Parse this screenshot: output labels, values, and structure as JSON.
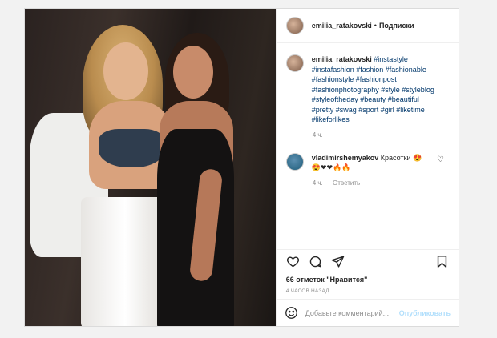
{
  "post": {
    "username": "emilia_ratakovski",
    "dot": "•",
    "follow_label": "Подписки",
    "caption": {
      "username": "emilia_ratakovski",
      "hashtags": "#instastyle #instafashion #fashion #fashionable #fashionstyle #fashionpost #fashionphotography #style #styleblog #styleoftheday #beauty #beautiful #pretty #swag #sport #girl #liketime #likeforlikes",
      "time": "4 ч."
    },
    "comment": {
      "username": "vladimirshemyakov",
      "text": "Красотки",
      "emoji_line": "😍❤❤🔥🔥",
      "time": "4 ч.",
      "reply_label": "Ответить"
    },
    "likes_text": "66 отметок \"Нравится\"",
    "posted_time": "4 ЧАСОВ НАЗАД",
    "comment_placeholder": "Добавьте комментарий...",
    "publish_label": "Опубликовать"
  },
  "icons": {
    "like": "heart-icon",
    "comment": "comment-icon",
    "share": "share-icon",
    "save": "bookmark-icon",
    "emoji": "smiley-icon"
  }
}
